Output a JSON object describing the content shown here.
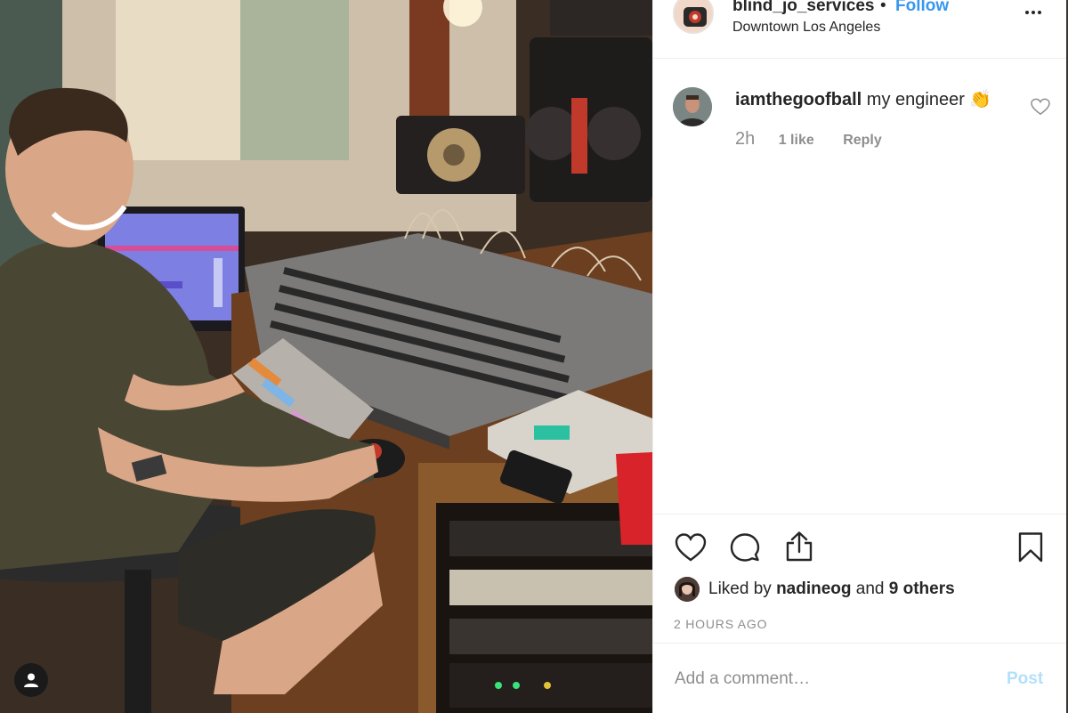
{
  "post": {
    "username": "blind_jo_services",
    "separator": "•",
    "follow_label": "Follow",
    "location": "Downtown Los Angeles",
    "more_icon": "more-horizontal-icon"
  },
  "comments": [
    {
      "username": "iamthegoofball",
      "text": "my engineer",
      "emoji": "👏",
      "time": "2h",
      "likes": "1 like",
      "reply_label": "Reply"
    }
  ],
  "actions": {
    "icons": [
      "heart-icon",
      "comment-icon",
      "share-icon",
      "bookmark-icon"
    ]
  },
  "liked_by": {
    "prefix": "Liked by",
    "user": "nadineog",
    "conjunction": "and",
    "others": "9 others"
  },
  "timestamp": "2 HOURS AGO",
  "add_comment": {
    "placeholder": "Add a comment…",
    "post_label": "Post"
  },
  "colors": {
    "link_blue": "#3897f0",
    "post_disabled": "#b2dffc",
    "muted_text": "#8e8e8e",
    "divider": "#efefef"
  }
}
